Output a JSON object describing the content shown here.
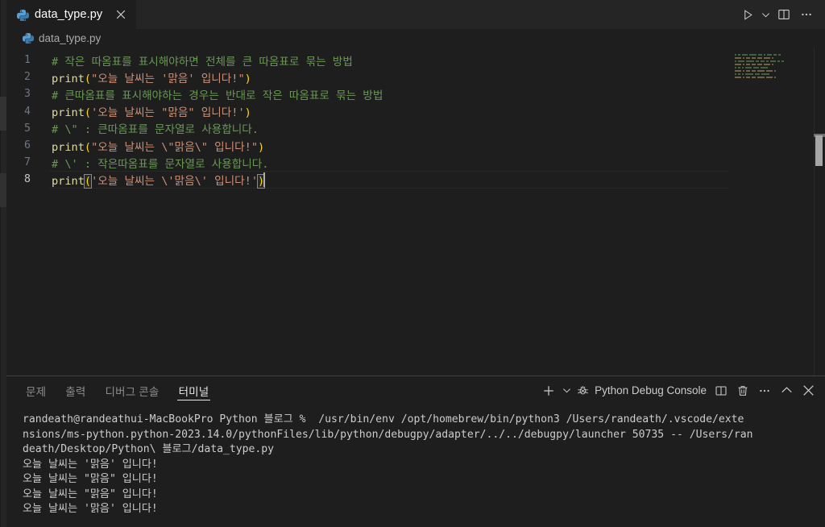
{
  "window": {
    "title": "data_type.py"
  },
  "tabbar": {
    "tabs": [
      {
        "label": "data_type.py",
        "icon": "python-icon",
        "close_icon": "close-icon",
        "active": true
      }
    ],
    "actions": [
      {
        "name": "run-python-file-button",
        "icon": "play-icon",
        "tooltip": "Run Python File"
      },
      {
        "name": "run-options-dropdown",
        "icon": "chevron-down-icon",
        "tooltip": "Run or Debug..."
      },
      {
        "name": "split-editor-button",
        "icon": "split-editor-icon",
        "tooltip": "Split Editor"
      },
      {
        "name": "more-actions-button",
        "icon": "ellipsis-icon",
        "tooltip": "More Actions..."
      }
    ]
  },
  "breadcrumb": {
    "icon": "python-icon",
    "label": "data_type.py"
  },
  "editor": {
    "language": "python",
    "active_line": 8,
    "colors": {
      "background": "#1e1e1e",
      "comment": "#6a9955",
      "function": "#dcdcaa",
      "bracket": "#ffd700",
      "string": "#ce9178",
      "line_number": "#6e7681"
    },
    "lines": [
      {
        "n": "1",
        "tokens": [
          {
            "t": "comment",
            "v": "# 작은 따옴표를 표시해야하면 전체를 큰 따옴표로 묶는 방법"
          }
        ]
      },
      {
        "n": "2",
        "tokens": [
          {
            "t": "fn",
            "v": "print"
          },
          {
            "t": "paren",
            "v": "("
          },
          {
            "t": "str",
            "v": "\"오늘 날씨는 '맑음' 입니다!\""
          },
          {
            "t": "paren",
            "v": ")"
          }
        ]
      },
      {
        "n": "3",
        "tokens": [
          {
            "t": "comment",
            "v": "# 큰따옴표를 표시해야하는 경우는 반대로 작은 따옴표로 묶는 방법"
          }
        ]
      },
      {
        "n": "4",
        "tokens": [
          {
            "t": "fn",
            "v": "print"
          },
          {
            "t": "paren",
            "v": "("
          },
          {
            "t": "str",
            "v": "'오늘 날씨는 \"맑음\" 입니다!'"
          },
          {
            "t": "paren",
            "v": ")"
          }
        ]
      },
      {
        "n": "5",
        "tokens": [
          {
            "t": "comment",
            "v": "# \\\" : 큰따옴표를 문자열로 사용합니다."
          }
        ]
      },
      {
        "n": "6",
        "tokens": [
          {
            "t": "fn",
            "v": "print"
          },
          {
            "t": "paren",
            "v": "("
          },
          {
            "t": "str",
            "v": "\"오늘 날씨는 \\\"맑음\\\" 입니다!\""
          },
          {
            "t": "paren",
            "v": ")"
          }
        ]
      },
      {
        "n": "7",
        "tokens": [
          {
            "t": "comment",
            "v": "# \\' : 작은따옴표를 문자열로 사용합니다."
          }
        ]
      },
      {
        "n": "8",
        "tokens": [
          {
            "t": "fn",
            "v": "print"
          },
          {
            "t": "paren",
            "v": "("
          },
          {
            "t": "str",
            "v": "'오늘 날씨는 \\'맑음\\' 입니다!'"
          },
          {
            "t": "paren",
            "v": ")"
          }
        ]
      }
    ]
  },
  "panel": {
    "tabs": [
      {
        "label": "문제",
        "name": "tab-problems",
        "active": false
      },
      {
        "label": "출력",
        "name": "tab-output",
        "active": false
      },
      {
        "label": "디버그 콘솔",
        "name": "tab-debug-console",
        "active": false
      },
      {
        "label": "터미널",
        "name": "tab-terminal",
        "active": true
      }
    ],
    "actions": {
      "new_terminal_icon": "plus-icon",
      "new_terminal_dropdown_icon": "chevron-down-icon",
      "terminal_name": "Python Debug Console",
      "terminal_name_icon": "debug-console-icon",
      "split_icon": "split-panel-icon",
      "kill_icon": "trash-icon",
      "more_icon": "ellipsis-icon",
      "maximize_icon": "chevron-up-icon",
      "close_icon": "close-icon"
    },
    "terminal": {
      "lines": [
        "randeath@randeathui-MacBookPro Python 블로그 %  /usr/bin/env /opt/homebrew/bin/python3 /Users/randeath/.vscode/exte",
        "nsions/ms-python.python-2023.14.0/pythonFiles/lib/python/debugpy/adapter/../../debugpy/launcher 50735 -- /Users/ran",
        "death/Desktop/Python\\ 블로그/data_type.py",
        "오늘 날씨는 '맑음' 입니다!",
        "오늘 날씨는 \"맑음\" 입니다!",
        "오늘 날씨는 \"맑음\" 입니다!",
        "오늘 날씨는 '맑음' 입니다!"
      ]
    }
  }
}
